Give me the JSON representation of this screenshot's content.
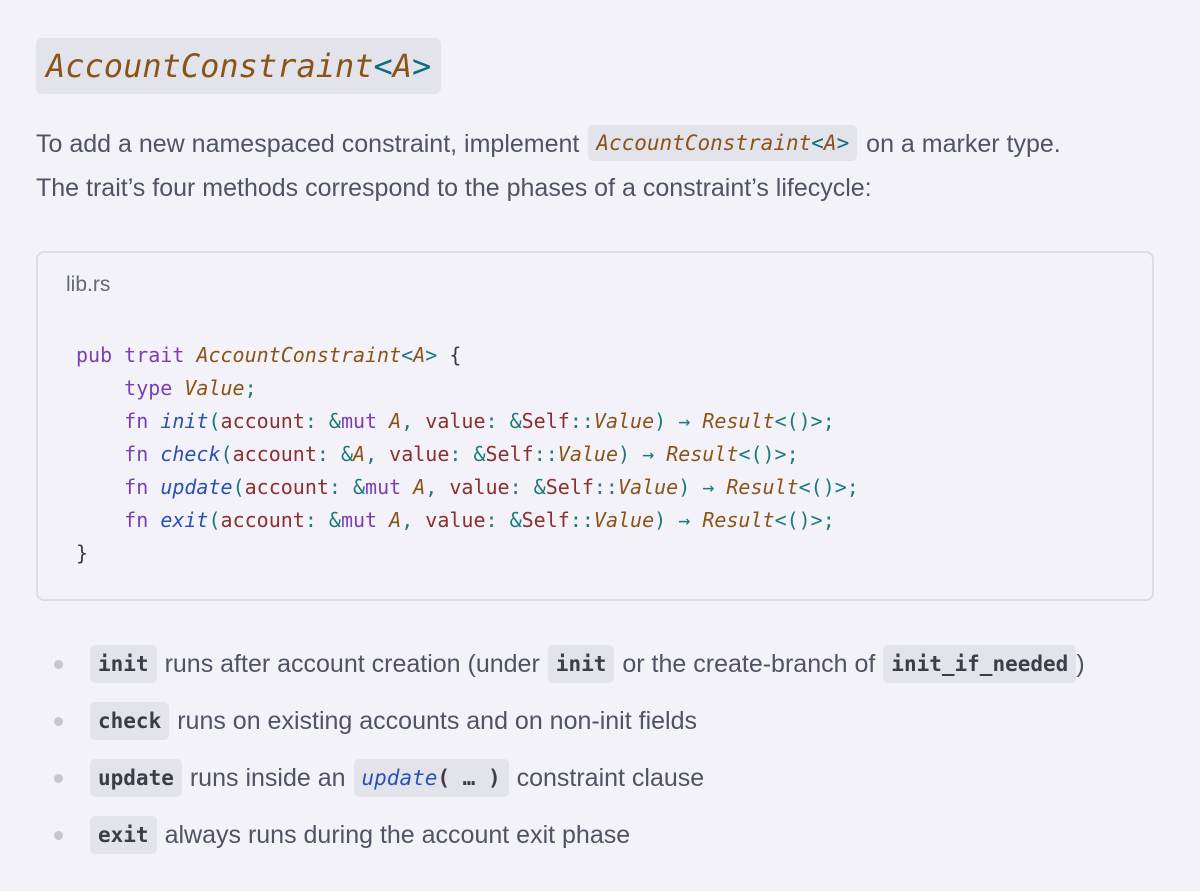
{
  "heading": {
    "name": "AccountConstraint",
    "open": "<",
    "param": "A",
    "close": ">"
  },
  "intro": {
    "line1_before": "To add a new namespaced constraint, implement",
    "code_name": "AccountConstraint",
    "code_open": "<",
    "code_param": "A",
    "code_close": ">",
    "line1_after": "on a marker type.",
    "line2": "The trait’s four methods correspond to the phases of a constraint’s lifecycle:"
  },
  "code_block": {
    "filename": "lib.rs",
    "lines": [
      "pub trait AccountConstraint<A> {",
      "    type Value;",
      "    fn init(account: &mut A, value: &Self::Value) → Result<()>;",
      "    fn check(account: &A, value: &Self::Value) → Result<()>;",
      "    fn update(account: &mut A, value: &Self::Value) → Result<()>;",
      "    fn exit(account: &mut A, value: &Self::Value) → Result<()>;",
      "}"
    ]
  },
  "bullets": [
    {
      "code": "init",
      "text1": "runs after account creation (under",
      "code2": "init",
      "text2": "or the create-branch of",
      "code3": "init_if_needed",
      "text3": ")"
    },
    {
      "code": "check",
      "text1": "runs on existing accounts and on non-init fields"
    },
    {
      "code": "update",
      "text1": "runs inside an",
      "fn_code": "update",
      "fn_args": "( … )",
      "text2": "constraint clause"
    },
    {
      "code": "exit",
      "text1": "always runs during the account exit phase"
    }
  ],
  "colors": {
    "background": "#f2f2f8",
    "inline_code_bg": "#e3e3ec",
    "type_name": "#8a5418",
    "keyword": "#7a3fb8",
    "function_name": "#2b50b4",
    "parameter": "#8b2f2f",
    "punctuation": "#1b7a7a"
  }
}
